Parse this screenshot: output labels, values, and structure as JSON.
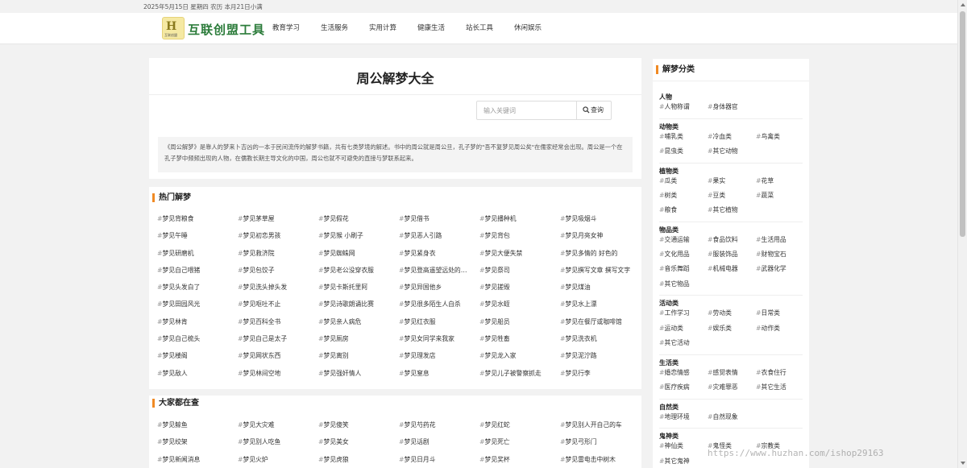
{
  "topbar": {
    "date": "2025年5月15日 星期四 农历 本月21日小满"
  },
  "header": {
    "logo_text": "互联创盟工具",
    "logo_small": "互联创盟",
    "nav": [
      "教育学习",
      "生活服务",
      "实用计算",
      "健康生活",
      "站长工具",
      "休闲娱乐"
    ]
  },
  "hero": {
    "title": "周公解梦大全",
    "search_placeholder": "输入关键词",
    "search_button": "查询",
    "description": "《周公解梦》是靠人的梦来卜吉凶的一本于民间流传的解梦书籍，共有七类梦境的解述。书中的周公就是周公旦，孔子梦的\"吾不复梦见周公矣\"在儒家经常会出现。周公是一个在孔子梦中频频出现的人物，在儒教长期主导文化的中国，周公也就不可避免的直接与梦联系起来。"
  },
  "hot": {
    "title": "热门解梦",
    "items": [
      "梦见背粮食",
      "梦见茅草屋",
      "梦见假花",
      "梦见借书",
      "梦见播种机",
      "梦见吸烟斗",
      "梦见午睡",
      "梦见初恋男孩",
      "梦见猴 小刷子",
      "梦见恶人引路",
      "梦见背包",
      "梦见月亮女神",
      "梦见研磨机",
      "梦见救济院",
      "梦见蜘蛛网",
      "梦见紧身衣",
      "梦见大便失禁",
      "梦见多情的 好色的",
      "梦见自己喂猪",
      "梦见包饺子",
      "梦见老公没穿衣服",
      "梦见登高遥望远处的风景",
      "梦见祭司",
      "梦见撰写文章 撰写文字",
      "梦见头发白了",
      "梦见洗头掉头发",
      "梦见卡斯托里阿",
      "梦见异国他乡",
      "梦见搓毁",
      "梦见煤油",
      "梦见田园风光",
      "梦见呕吐不止",
      "梦见诗歌朗诵比赛",
      "梦见很多陌生人自杀",
      "梦见水蛭",
      "梦见水上漂",
      "梦见林肯",
      "梦见百科全书",
      "梦见亲人病危",
      "梦见红衣服",
      "梦见船员",
      "梦见在餐厅或咖啡馆",
      "梦见自己梳头",
      "梦见自己是太子",
      "梦见厕房",
      "梦见女同学来我家",
      "梦见牲畜",
      "梦见洗衣机",
      "梦见楼阁",
      "梦见网状东西",
      "梦见离别",
      "梦见理发店",
      "梦见龙入家",
      "梦见泥泞路",
      "梦见敌人",
      "梦见林间空地",
      "梦见强奸情人",
      "梦见窒息",
      "梦见儿子被警察抓走",
      "梦见行李"
    ]
  },
  "look": {
    "title": "大家都在查",
    "items": [
      "梦见鲸鱼",
      "梦见大灾难",
      "梦见傻笑",
      "梦见芍药花",
      "梦见红蛇",
      "梦见别人开自己的车",
      "梦见绞架",
      "梦见别人吃鱼",
      "梦见美女",
      "梦见话剧",
      "梦见死亡",
      "梦见弓形门",
      "梦见新闻消息",
      "梦见火炉",
      "梦见虎狼",
      "梦见日月斗",
      "梦见奖杯",
      "梦见雷电击中树木"
    ]
  },
  "side": {
    "title": "解梦分类",
    "categories": [
      {
        "name": "人物",
        "items": [
          "人物称谓",
          "身体器官"
        ]
      },
      {
        "name": "动物类",
        "items": [
          "哺乳类",
          "冷血类",
          "鸟禽类",
          "昆虫类",
          "其它动物"
        ]
      },
      {
        "name": "植物类",
        "items": [
          "瓜类",
          "果实",
          "花草",
          "树类",
          "豆类",
          "蔬菜",
          "粮食",
          "其它植物"
        ]
      },
      {
        "name": "物品类",
        "items": [
          "交通运输",
          "食品饮料",
          "生活用品",
          "文化用品",
          "服装饰品",
          "财物宝石",
          "音乐舞蹈",
          "机械电器",
          "武器化学",
          "其它物品"
        ]
      },
      {
        "name": "活动类",
        "items": [
          "工作学习",
          "劳动类",
          "日常类",
          "运动类",
          "娱乐类",
          "动作类",
          "其它活动"
        ]
      },
      {
        "name": "生活类",
        "items": [
          "婚恋情感",
          "感觉表情",
          "衣食住行",
          "医疗疾病",
          "灾难罪恶",
          "其它生活"
        ]
      },
      {
        "name": "自然类",
        "items": [
          "地理环境",
          "自然现象"
        ]
      },
      {
        "name": "鬼神类",
        "items": [
          "神仙类",
          "鬼怪类",
          "宗教类",
          "其它鬼神"
        ]
      }
    ]
  },
  "watermark": "https://www.huzhan.com/ishop29163"
}
